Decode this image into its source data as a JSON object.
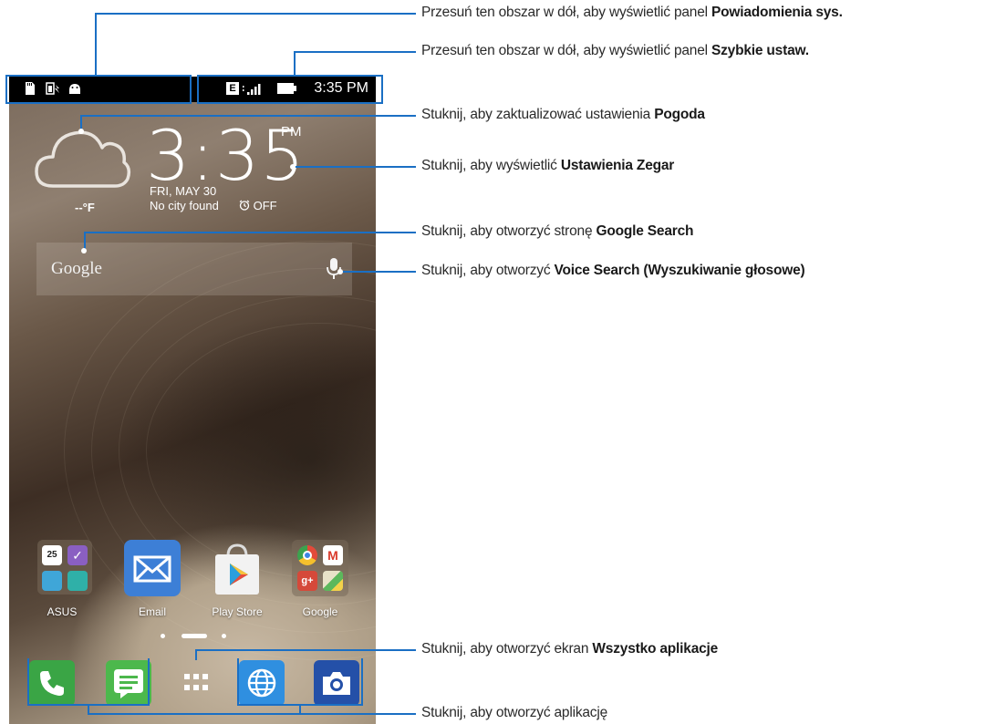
{
  "annotations": [
    {
      "text": "Przesuń ten obszar w dół, aby wyświetlić panel ",
      "bold": "Powiadomienia sys."
    },
    {
      "text": "Przesuń ten obszar w dół, aby wyświetlić panel ",
      "bold": "Szybkie ustaw."
    },
    {
      "text": "Stuknij, aby zaktualizować ustawienia ",
      "bold": "Pogoda"
    },
    {
      "text": "Stuknij, aby wyświetlić ",
      "bold": "Ustawienia Zegar"
    },
    {
      "text": "Stuknij, aby otworzyć stronę ",
      "bold": "Google Search"
    },
    {
      "text": "Stuknij, aby otworzyć ",
      "bold": "Voice Search (Wyszukiwanie głosowe)"
    },
    {
      "text": "Stuknij, aby otworzyć ekran ",
      "bold": "Wszystko aplikacje"
    },
    {
      "text": "Stuknij, aby otworzyć aplikację",
      "bold": ""
    }
  ],
  "status_bar": {
    "time": "3:35 PM",
    "network": "E",
    "left_icons": [
      "sd-card-icon",
      "battery-charge-icon",
      "android-debug-icon"
    ],
    "right_icons": [
      "network-e-icon",
      "signal-icon",
      "battery-icon"
    ]
  },
  "clock": {
    "time": "3:35",
    "ampm": "PM",
    "date": "FRI, MAY 30",
    "city": "No city found",
    "alarm": "OFF"
  },
  "weather": {
    "temperature": "--°F",
    "icon": "cloud-icon"
  },
  "search": {
    "logo": "Google",
    "mic_icon": "microphone-icon"
  },
  "apps": [
    {
      "label": "ASUS",
      "icon": "asus-folder-icon"
    },
    {
      "label": "Email",
      "icon": "email-icon"
    },
    {
      "label": "Play Store",
      "icon": "play-store-icon"
    },
    {
      "label": "Google",
      "icon": "google-folder-icon"
    }
  ],
  "asus_folder": {
    "calendar_day": "25"
  },
  "dock": [
    {
      "name": "phone",
      "icon": "phone-icon"
    },
    {
      "name": "messaging",
      "icon": "message-icon"
    },
    {
      "name": "all-apps",
      "icon": "all-apps-icon"
    },
    {
      "name": "browser",
      "icon": "globe-icon"
    },
    {
      "name": "camera",
      "icon": "camera-icon"
    }
  ],
  "colors": {
    "annotation_blue": "#1a6fc4",
    "email_blue": "#3d7fd6",
    "phone_green": "#3aa545",
    "message_green": "#4cb84c",
    "browser_blue": "#2f8fe0",
    "camera_blue": "#2450a8"
  },
  "page_indicator": {
    "pages": 3,
    "current": 2
  }
}
